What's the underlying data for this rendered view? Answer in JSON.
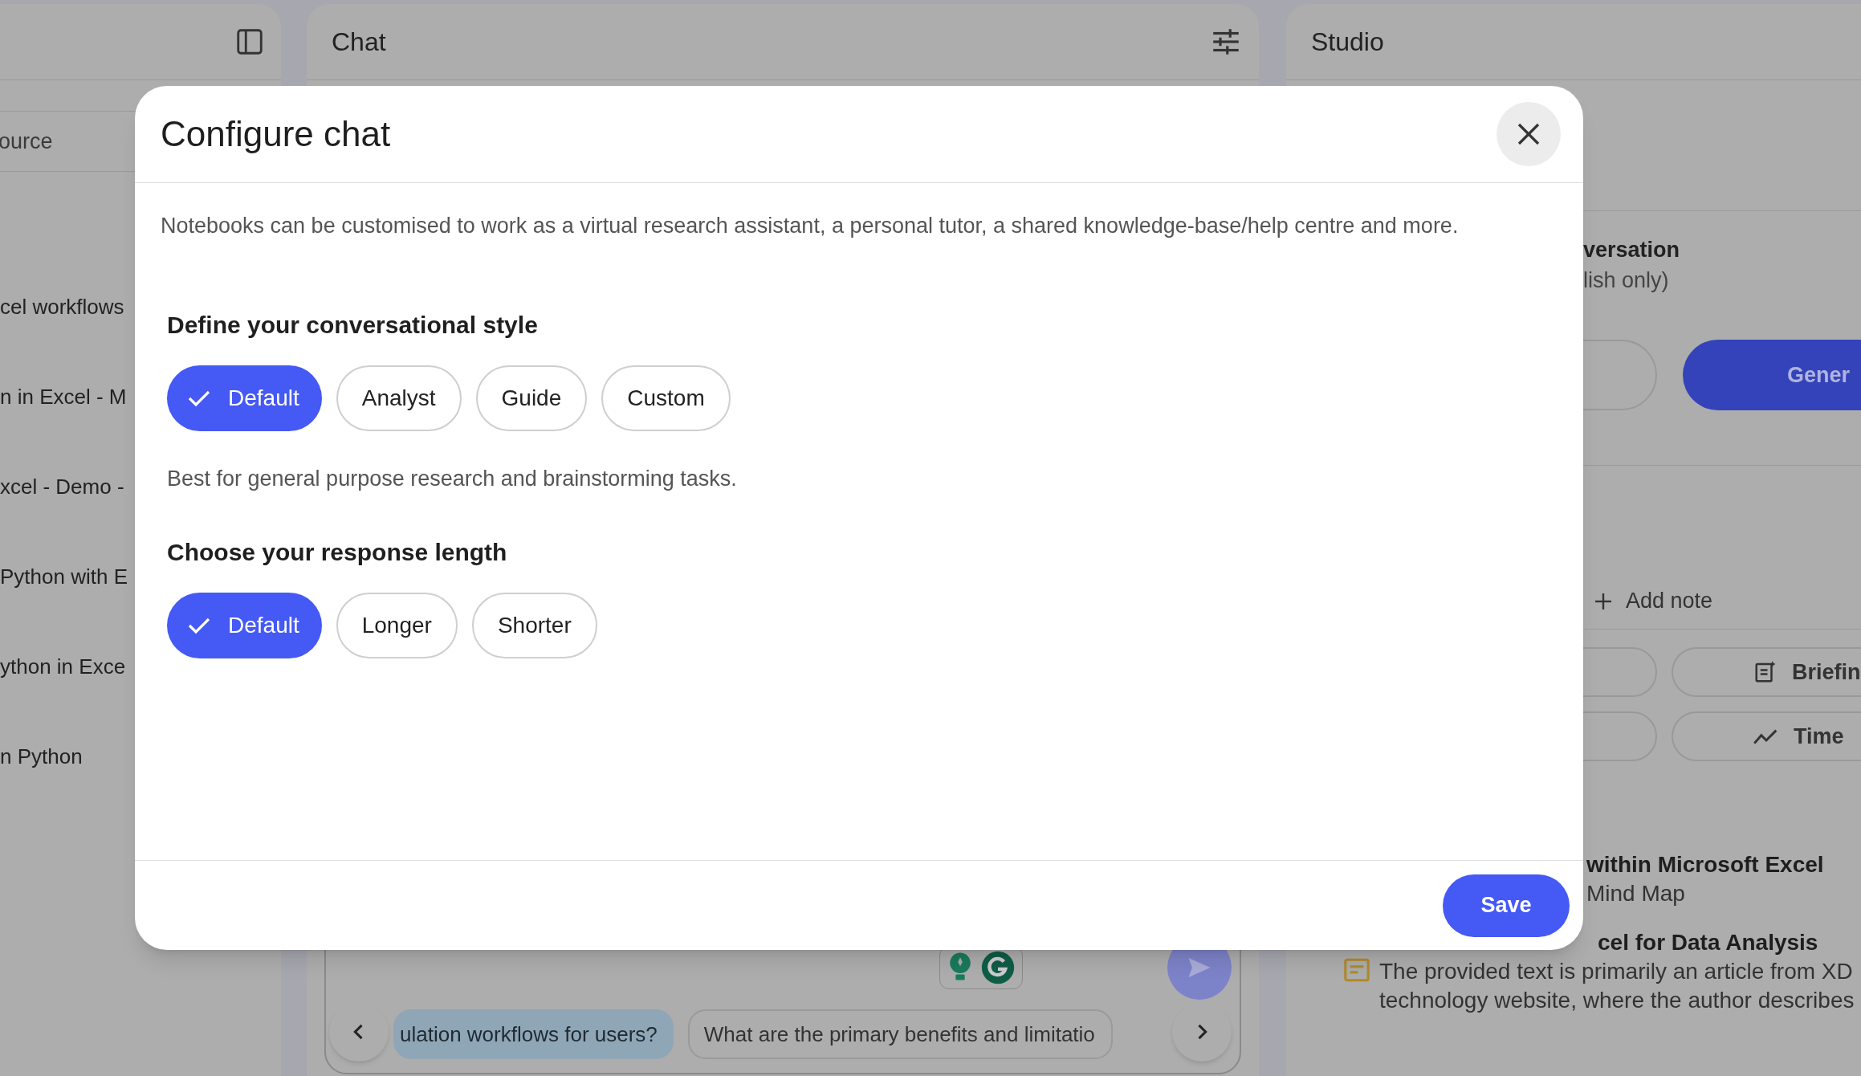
{
  "sources_panel": {
    "header_fragment": "ource",
    "items": [
      "cel workflows",
      "n in Excel - M",
      "xcel - Demo -",
      "Python with E",
      "ython in Exce",
      "n Python"
    ]
  },
  "chat_panel": {
    "title": "Chat",
    "suggestions": [
      {
        "text": "ulation workflows for users?",
        "highlighted": true
      },
      {
        "text": "What are the primary benefits and limitatio",
        "highlighted": false
      }
    ]
  },
  "studio_panel": {
    "title": "Studio",
    "audio_overview": {
      "title": "versation",
      "subtitle": "lish only)",
      "generate_button": "Gener"
    },
    "add_note": "Add note",
    "note_buttons": [
      {
        "label": "Briefin",
        "kind": "briefing"
      },
      {
        "label": "Time",
        "kind": "timeline"
      }
    ],
    "notes": [
      {
        "title": "within Microsoft Excel",
        "lines": [
          "Mind Map"
        ]
      },
      {
        "title": "cel for Data Analysis",
        "lines": [
          "The provided text is primarily an article from XD",
          "technology website, where the author describes"
        ]
      }
    ]
  },
  "dialog": {
    "title": "Configure chat",
    "description": "Notebooks can be customised to work as a virtual research assistant, a personal tutor, a shared knowledge-base/help centre and more.",
    "sections": [
      {
        "heading": "Define your conversational style",
        "options": [
          {
            "label": "Default",
            "selected": true
          },
          {
            "label": "Analyst",
            "selected": false
          },
          {
            "label": "Guide",
            "selected": false
          },
          {
            "label": "Custom",
            "selected": false
          }
        ],
        "hint": "Best for general purpose research and brainstorming tasks."
      },
      {
        "heading": "Choose your response length",
        "options": [
          {
            "label": "Default",
            "selected": true
          },
          {
            "label": "Longer",
            "selected": false
          },
          {
            "label": "Shorter",
            "selected": false
          }
        ]
      }
    ],
    "save_button": "Save"
  }
}
